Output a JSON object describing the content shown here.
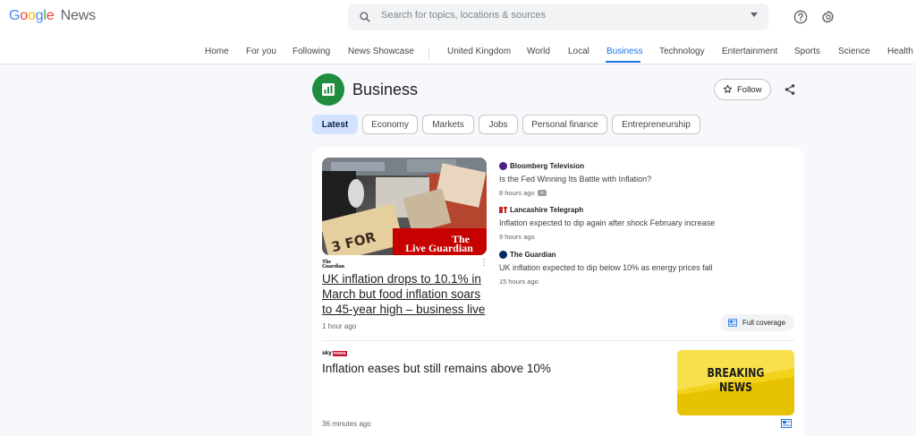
{
  "header": {
    "logo_google": "Google",
    "logo_news": "News",
    "search_placeholder": "Search for topics, locations & sources",
    "icons": [
      "search-icon",
      "dropdown-caret-icon",
      "help-icon",
      "settings-gear-icon"
    ]
  },
  "nav": {
    "items": [
      "Home",
      "For you",
      "Following",
      "News Showcase",
      "United Kingdom",
      "World",
      "Local",
      "Business",
      "Technology",
      "Entertainment",
      "Sports",
      "Science",
      "Health"
    ],
    "active": "Business"
  },
  "topic": {
    "title": "Business",
    "follow_label": "Follow",
    "chips": [
      "Latest",
      "Economy",
      "Markets",
      "Jobs",
      "Personal finance",
      "Entrepreneurship"
    ],
    "active_chip": "Latest"
  },
  "cluster": {
    "hero": {
      "image_text_1": "3 FOR",
      "image_brand_top": "The",
      "image_brand_bottom": "Live Guardian",
      "publisher_logo_top": "The",
      "publisher_logo_bottom": "Guardian",
      "title": "UK inflation drops to 10.1% in March but food inflation soars to 45-year high – business live",
      "time": "1 hour ago"
    },
    "side_stories": [
      {
        "source": "Bloomberg Television",
        "title": "Is the Fed Winning Its Battle with Inflation?",
        "time": "8 hours ago",
        "icon_color": "#4b1f8c"
      },
      {
        "source": "Lancashire Telegraph",
        "title": "Inflation expected to dip again after shock February increase",
        "time": "9 hours ago",
        "icon_color": "#c62828"
      },
      {
        "source": "The Guardian",
        "title": "UK inflation expected to dip below 10% as energy prices fall",
        "time": "15 hours ago",
        "icon_color": "#052962"
      }
    ],
    "full_coverage_label": "Full coverage"
  },
  "story2": {
    "source_logo_left": "sky",
    "source_logo_right": "news",
    "title": "Inflation eases but still remains above 10%",
    "time": "36 minutes ago",
    "image_line1": "BREAKING",
    "image_line2": "NEWS"
  },
  "colors": {
    "accent": "#1a73e8",
    "topic_green": "#1e8e3e",
    "chip_active": "#d3e3fd",
    "breaking_yellow": "#f2d21c"
  }
}
